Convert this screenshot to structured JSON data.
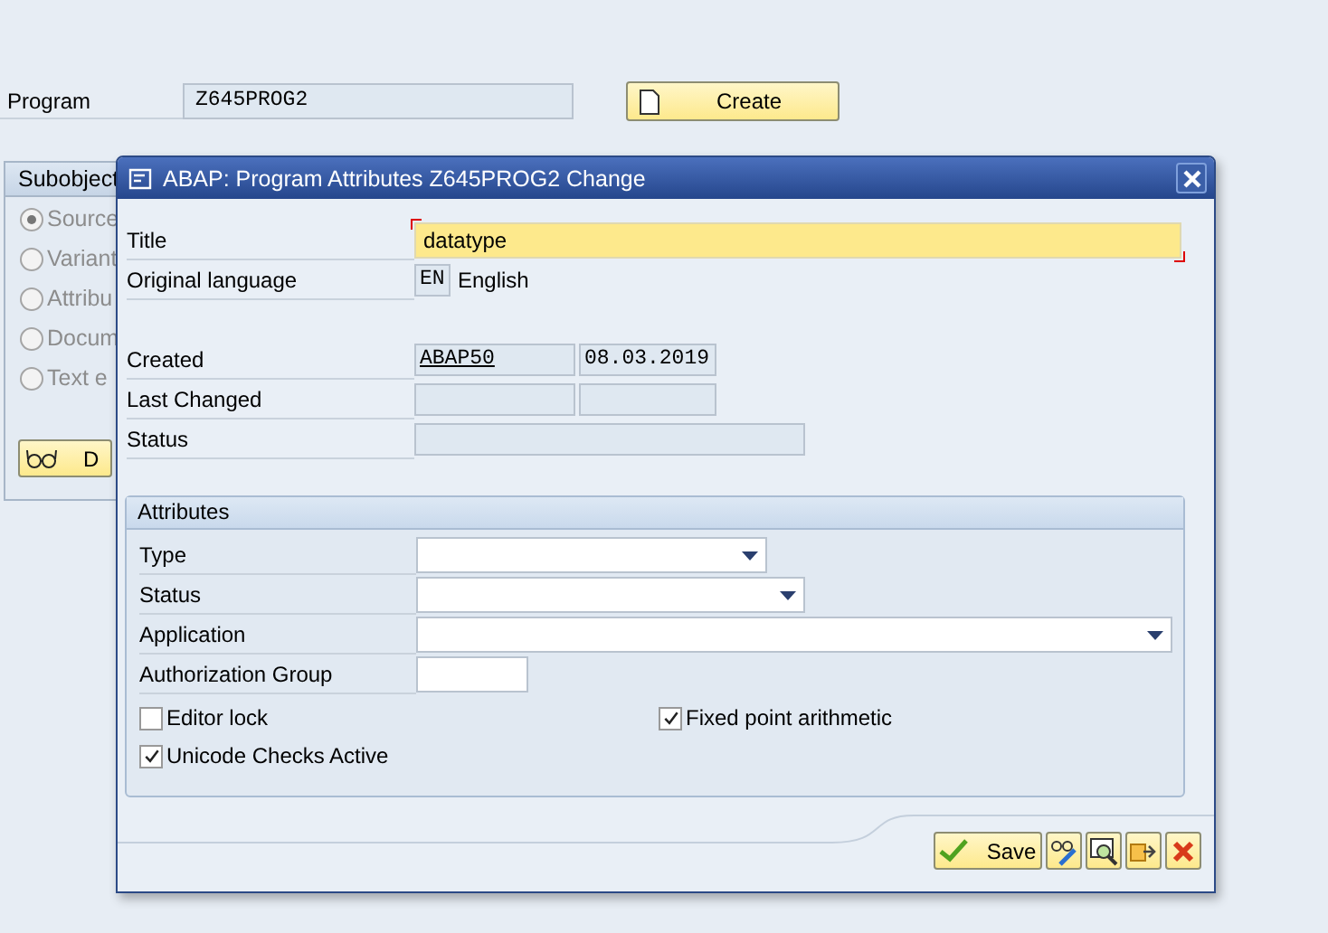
{
  "main": {
    "program_label": "Program",
    "program_value": "Z645PROG2",
    "create_button": "Create",
    "subobjects": {
      "title": "Subobject",
      "options": [
        {
          "label": "Source",
          "selected": true
        },
        {
          "label": "Variant",
          "selected": false
        },
        {
          "label": "Attribu",
          "selected": false
        },
        {
          "label": "Docum",
          "selected": false
        },
        {
          "label": "Text e",
          "selected": false
        }
      ],
      "display_button": "D"
    }
  },
  "dialog": {
    "title": "ABAP: Program Attributes Z645PROG2 Change",
    "title_field": {
      "label": "Title",
      "value": "datatype"
    },
    "original_language": {
      "label": "Original language",
      "code": "EN",
      "name": "English"
    },
    "created": {
      "label": "Created",
      "user": "ABAP50",
      "date": "08.03.2019"
    },
    "last_changed": {
      "label": "Last Changed"
    },
    "status": {
      "label": "Status"
    },
    "attributes": {
      "title": "Attributes",
      "dropdowns": [
        {
          "label": "Type"
        },
        {
          "label": "Status"
        },
        {
          "label": "Application"
        }
      ],
      "authorization_group": {
        "label": "Authorization Group"
      },
      "checkboxes": [
        {
          "label": "Editor lock",
          "checked": false
        },
        {
          "label": "Fixed point arithmetic",
          "checked": true
        },
        {
          "label": "Unicode Checks Active",
          "checked": true
        }
      ]
    },
    "save_button": "Save"
  }
}
